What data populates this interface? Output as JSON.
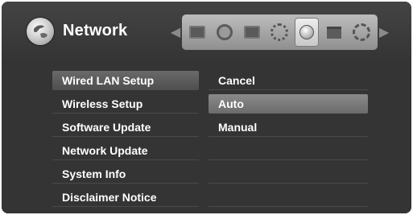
{
  "header": {
    "title": "Network",
    "icon": "network-globe-icon",
    "categories": [
      {
        "icon": "tv-icon",
        "active": false
      },
      {
        "icon": "speaker-icon",
        "active": false
      },
      {
        "icon": "display-icon",
        "active": false
      },
      {
        "icon": "lock-gear-icon",
        "active": false
      },
      {
        "icon": "network-globe-icon",
        "active": true
      },
      {
        "icon": "folder-icon",
        "active": false
      },
      {
        "icon": "settings-gear-icon",
        "active": false
      }
    ]
  },
  "menu": {
    "items": [
      {
        "label": "Wired LAN Setup",
        "selected": true
      },
      {
        "label": "Wireless Setup",
        "selected": false
      },
      {
        "label": "Software Update",
        "selected": false
      },
      {
        "label": "Network Update",
        "selected": false
      },
      {
        "label": "System Info",
        "selected": false
      },
      {
        "label": "Disclaimer Notice",
        "selected": false
      }
    ]
  },
  "submenu": {
    "items": [
      {
        "label": "Cancel",
        "selected": false
      },
      {
        "label": "Auto",
        "selected": true
      },
      {
        "label": "Manual",
        "selected": false
      },
      {
        "label": "",
        "selected": false
      },
      {
        "label": "",
        "selected": false
      },
      {
        "label": "",
        "selected": false
      }
    ]
  }
}
